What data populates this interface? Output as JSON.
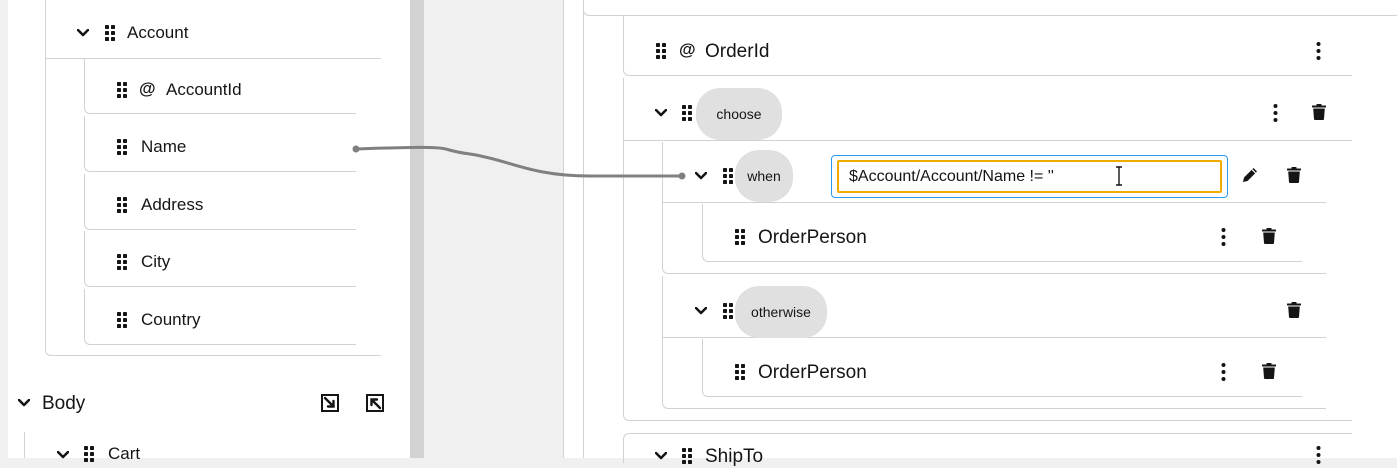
{
  "source": {
    "parent": {
      "label": "Account"
    },
    "fields": [
      {
        "label": "AccountId",
        "prefix": "@"
      },
      {
        "label": "Name"
      },
      {
        "label": "Address"
      },
      {
        "label": "City"
      },
      {
        "label": "Country"
      }
    ],
    "body": {
      "label": "Body"
    },
    "cart": {
      "label": "Cart"
    }
  },
  "target": {
    "order_id": {
      "label": "OrderId",
      "prefix": "@"
    },
    "choose": {
      "label": "choose"
    },
    "when": {
      "label": "when",
      "expression": "$Account/Account/Name != ''"
    },
    "order_person_1": {
      "label": "OrderPerson"
    },
    "otherwise": {
      "label": "otherwise"
    },
    "order_person_2": {
      "label": "OrderPerson"
    },
    "ship_to": {
      "label": "ShipTo"
    }
  },
  "icons": {
    "drag": "drag-handle-icon",
    "expand": "chevron-down-icon",
    "menu": "kebab-icon",
    "delete": "trash-icon",
    "edit": "pencil-icon",
    "import": "import-icon",
    "export": "export-icon"
  },
  "colors": {
    "mapping_line": "#808080",
    "input_focus_border": "#f0ab00",
    "input_outer_border": "#2b9af3"
  }
}
